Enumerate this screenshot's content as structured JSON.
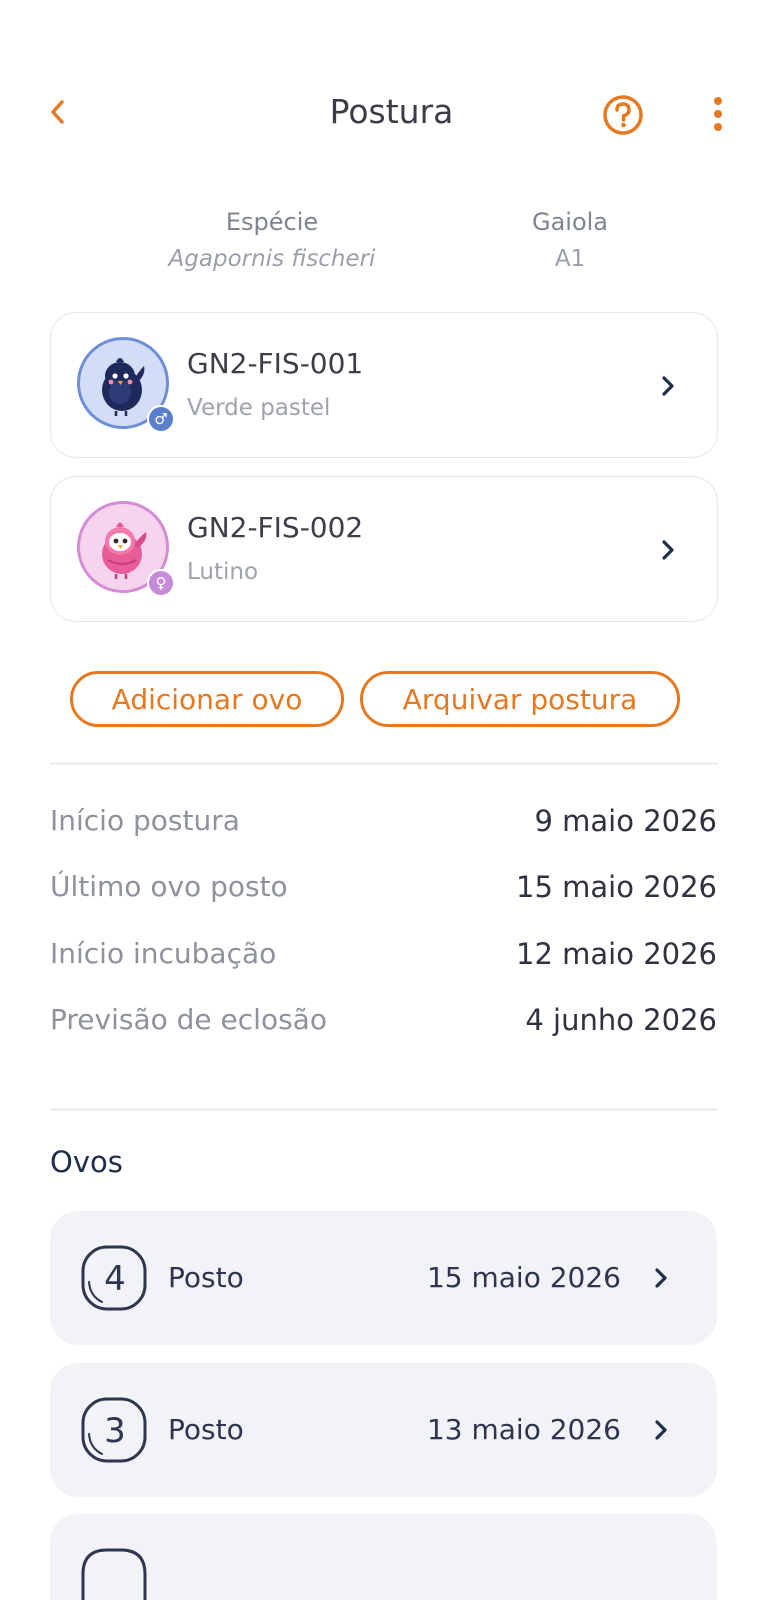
{
  "header": {
    "title": "Postura",
    "back_icon": "chevron-left-icon",
    "help_icon": "question-circle-icon",
    "more_icon": "more-vertical-icon",
    "accent": "#E57820"
  },
  "info": {
    "species_label": "Espécie",
    "species_value": "Agapornis fischeri",
    "cage_label": "Gaiola",
    "cage_value": "A1"
  },
  "birds": [
    {
      "id": "GN2-FIS-001",
      "mutation": "Verde pastel",
      "sex": "male",
      "sex_symbol": "♂",
      "ring_color": "#6E8FD8",
      "bg_color": "#D4DDF6",
      "badge_color": "#5B7FCB"
    },
    {
      "id": "GN2-FIS-002",
      "mutation": "Lutino",
      "sex": "female",
      "sex_symbol": "♀",
      "ring_color": "#D58BD8",
      "bg_color": "#F6D4EE",
      "badge_color": "#C88AD8"
    }
  ],
  "actions": {
    "add_egg": "Adicionar ovo",
    "archive": "Arquivar postura"
  },
  "details": [
    {
      "label": "Início postura",
      "value": "9 maio 2026"
    },
    {
      "label": "Último ovo posto",
      "value": "15 maio 2026"
    },
    {
      "label": "Início incubação",
      "value": "12 maio 2026"
    },
    {
      "label": "Previsão de eclosão",
      "value": "4 junho 2026"
    }
  ],
  "eggs_section": {
    "title": "Ovos",
    "items": [
      {
        "number": "4",
        "status": "Posto",
        "date": "15 maio 2026"
      },
      {
        "number": "3",
        "status": "Posto",
        "date": "13 maio 2026"
      }
    ]
  }
}
